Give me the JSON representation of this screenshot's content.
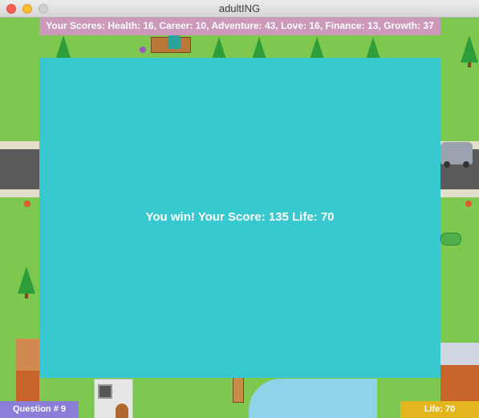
{
  "window": {
    "title": "adultING"
  },
  "scores": {
    "text": "Your Scores: Health: 16, Career: 10, Adventure: 43, Love: 16, Finance: 13, Growth: 37"
  },
  "result": {
    "message": "You win! Your Score: 135 Life: 70"
  },
  "status": {
    "question": "Question # 9",
    "life": "Life: 70"
  },
  "colors": {
    "modal": "#38c8d0",
    "score_bar": "#cc99bb",
    "question_badge": "#8c7ed8",
    "life_badge": "#e2b61c",
    "grass": "#7ec850"
  }
}
